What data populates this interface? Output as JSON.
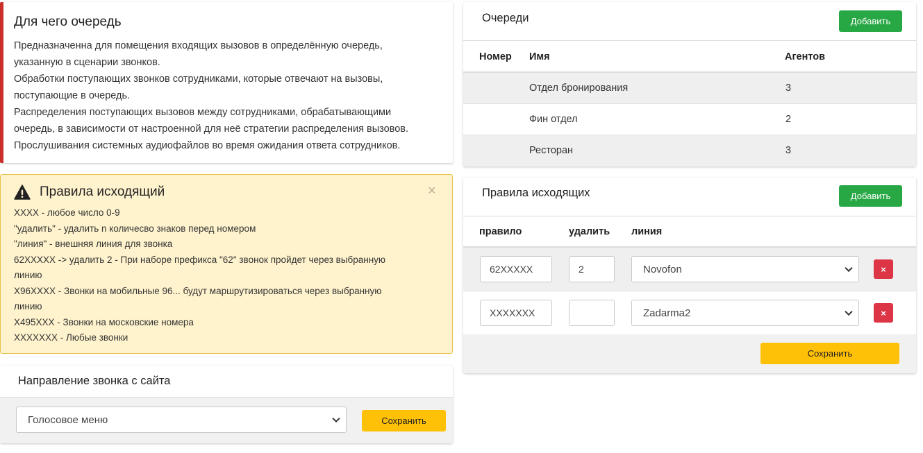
{
  "info": {
    "title": "Для чего очередь",
    "lines": [
      "Предназначенна для помещения входящих вызовов в определённую очередь,",
      "указанную в сценарии звонков.",
      "Обработки поступающих звонков сотрудниками, которые отвечают на вызовы,",
      "поступающие в очередь.",
      "Распределения поступающих вызовов между сотрудниками, обрабатывающими",
      "очередь, в зависимости от настроенной для неё стратегии распределения вызовов.",
      "Прослушивания системных аудиофайлов во время ожидания ответа сотрудников."
    ],
    "accent_color": "#c9302c"
  },
  "alert": {
    "title": "Правила исходящий",
    "close_label": "×",
    "icon": "warning-icon",
    "lines": [
      "XXXX - любое число 0-9",
      "\"удалить\" - удалить n количесво знаков перед номером",
      "\"линия\" - внешняя линия для звонка",
      "62XXXXX -> удалить 2 - При наборе префикса \"62\" звонок пройдет через выбранную",
      "линию",
      "X96XXXX - Звонки на мобильные 96... будут маршрутизироваться через выбранную",
      "линию",
      "X495XXX - Звонки на московские номера",
      "XXXXXXX - Любые звонки"
    ],
    "background_color": "#fff3cd"
  },
  "site_direction": {
    "title": "Направление звонка с сайта",
    "selected": "Голосовое меню",
    "save_label": "Сохранить"
  },
  "queues": {
    "title": "Очереди",
    "add_label": "Добавить",
    "columns": [
      "Номер",
      "Имя",
      "Агентов"
    ],
    "rows": [
      {
        "number": "",
        "name": "Отдел бронирования",
        "agents": "3"
      },
      {
        "number": "",
        "name": "Фин отдел",
        "agents": "2"
      },
      {
        "number": "",
        "name": "Ресторан",
        "agents": "3"
      }
    ]
  },
  "outgoing_rules": {
    "title": "Правила исходящих",
    "add_label": "Добавить",
    "columns": [
      "правило",
      "удалить",
      "линия"
    ],
    "rows": [
      {
        "rule": "62XXXXX",
        "delete": "2",
        "line": "Novofon",
        "remove_label": "×"
      },
      {
        "rule": "XXXXXXX",
        "delete": "",
        "line": "Zadarma2",
        "remove_label": "×"
      }
    ],
    "save_label": "Сохранить"
  },
  "colors": {
    "green": "#28a745",
    "yellow": "#ffc107",
    "red": "#dc3545"
  }
}
